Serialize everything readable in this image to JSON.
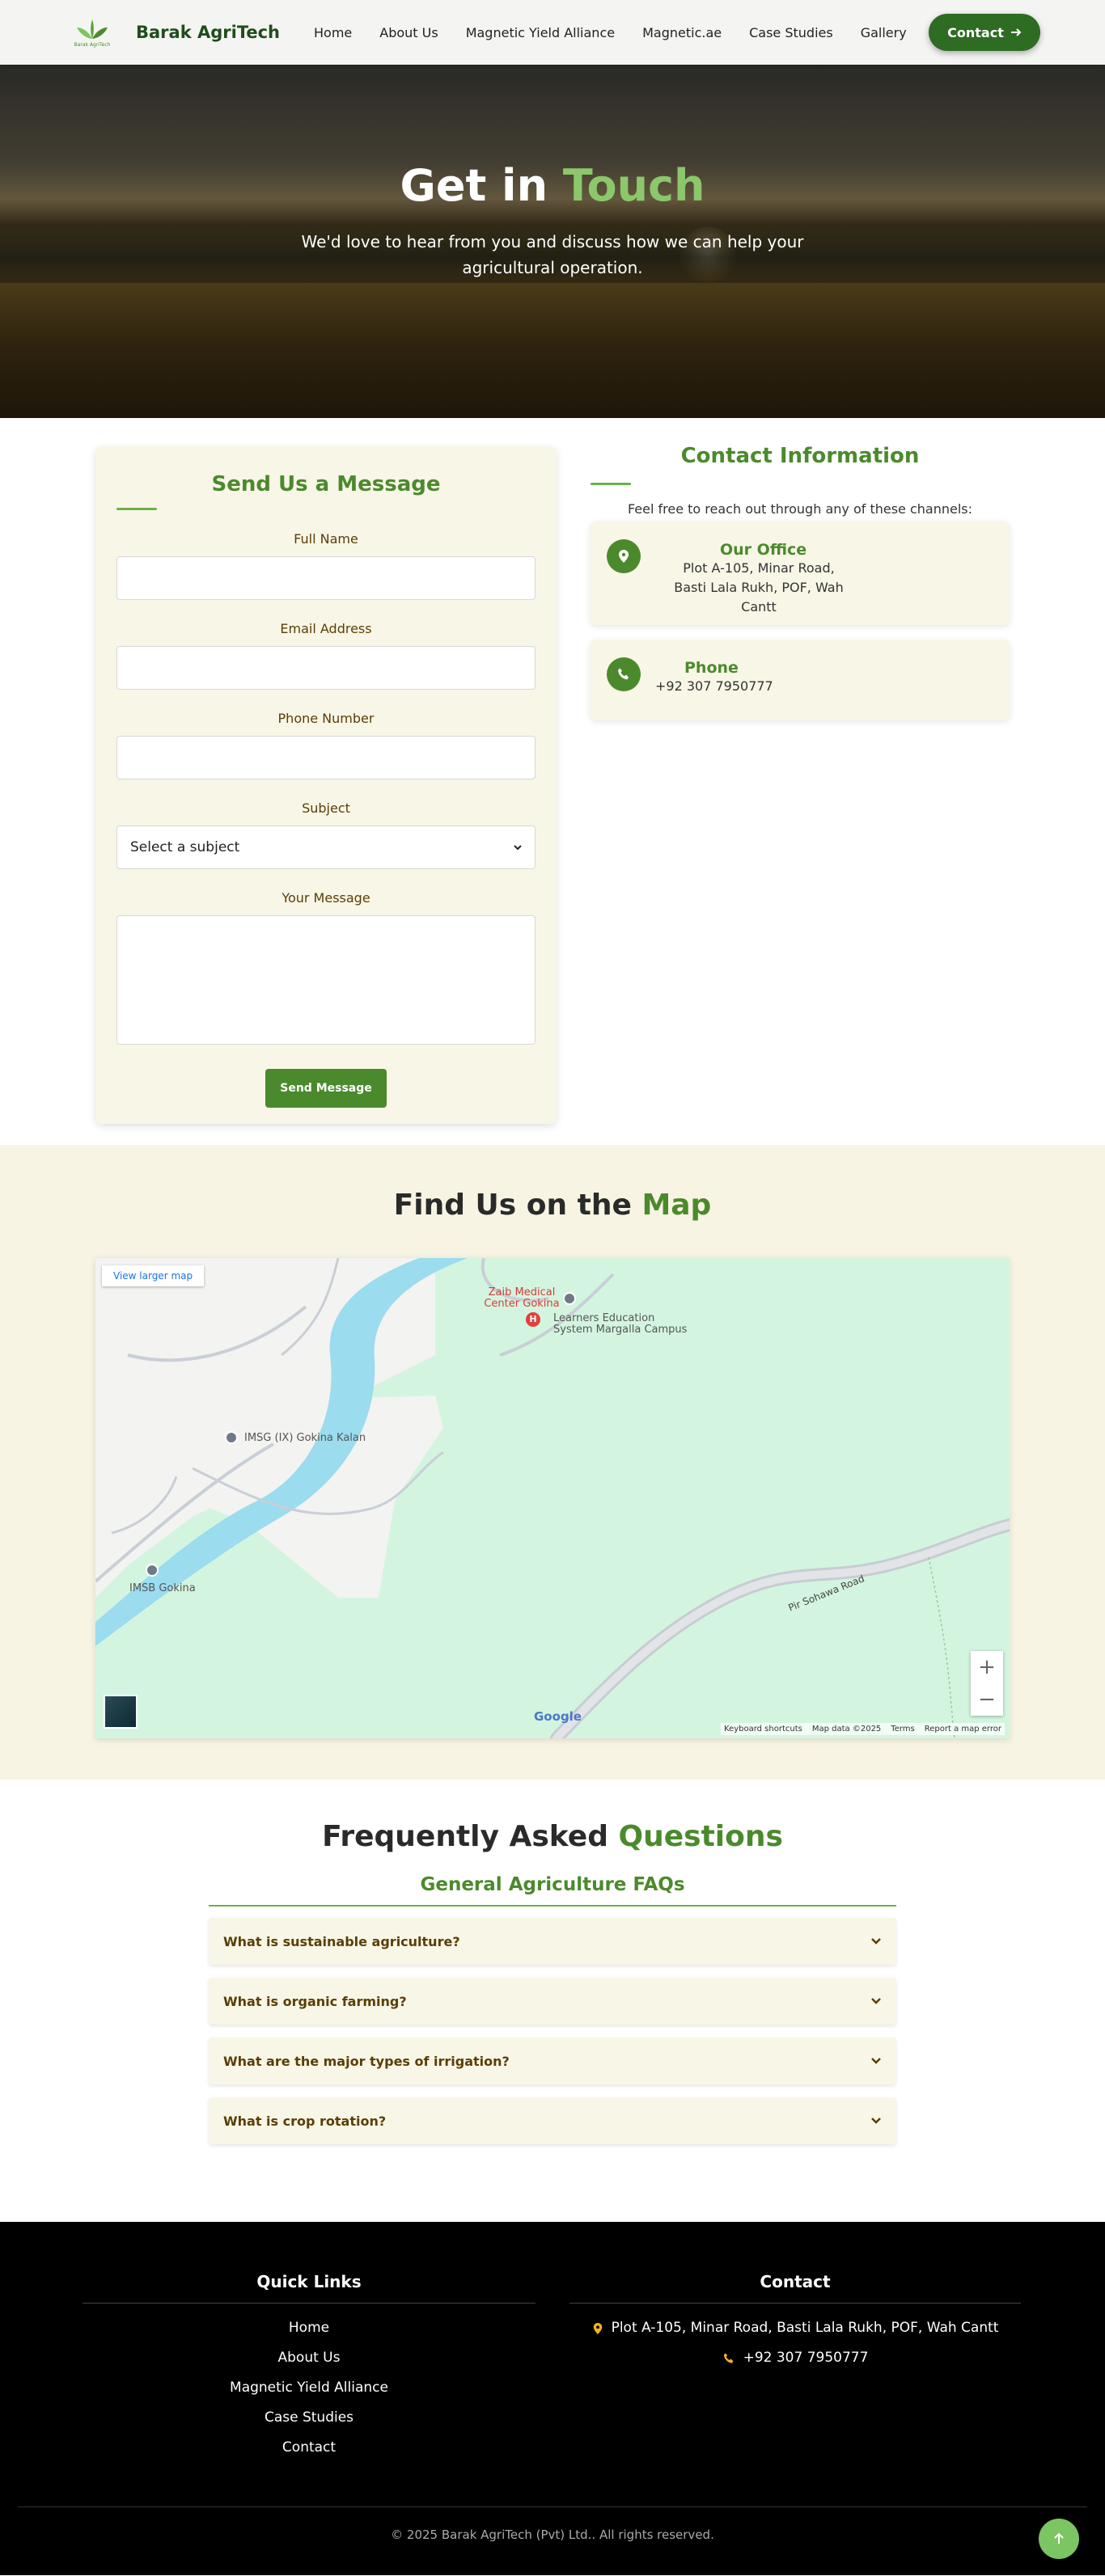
{
  "brand": {
    "name": "Barak AgriTech",
    "logo_text": "Barak AgriTech"
  },
  "nav": {
    "items": [
      {
        "label": "Home"
      },
      {
        "label": "About Us"
      },
      {
        "label": "Magnetic Yield Alliance"
      },
      {
        "label": "Magnetic.ae"
      },
      {
        "label": "Case Studies"
      },
      {
        "label": "Gallery"
      }
    ],
    "cta_label": "Contact"
  },
  "hero": {
    "title_plain": "Get in",
    "title_accent": "Touch",
    "subtitle": "We'd love to hear from you and discuss how we can help your agricultural operation."
  },
  "form": {
    "title": "Send Us a Message",
    "full_name_label": "Full Name",
    "email_label": "Email Address",
    "phone_label": "Phone Number",
    "subject_label": "Subject",
    "subject_value": "Select a subject",
    "message_label": "Your Message",
    "submit_label": "Send Message"
  },
  "contact_info": {
    "title": "Contact Information",
    "lead": "Feel free to reach out through any of these channels:",
    "office": {
      "title": "Our Office",
      "line1": "Plot A-105, Minar Road,",
      "line2": "Basti Lala Rukh, POF, Wah Cantt"
    },
    "phone": {
      "title": "Phone",
      "number": "+92 307 7950777"
    }
  },
  "map_section": {
    "title_plain": "Find Us on the",
    "title_accent": "Map",
    "larger_map_label": "View larger map",
    "pois": {
      "zaib": "Zaib Medical Center Gokina",
      "learners": "Learners Education System Margalla Campus",
      "imsg_ix": "IMSG (IX) Gokina Kalan",
      "imsb": "IMSB Gokina",
      "road": "Pir Sohawa Road"
    },
    "zoom_in": "+",
    "zoom_out": "−",
    "google": "Google",
    "attribution": {
      "shortcuts": "Keyboard shortcuts",
      "data": "Map data ©2025",
      "terms": "Terms",
      "report": "Report a map error"
    }
  },
  "faq": {
    "title_plain": "Frequently Asked",
    "title_accent": "Questions",
    "category": "General Agriculture FAQs",
    "items": [
      {
        "q": "What is sustainable agriculture?"
      },
      {
        "q": "What is organic farming?"
      },
      {
        "q": "What are the major types of irrigation?"
      },
      {
        "q": "What is crop rotation?"
      }
    ]
  },
  "footer": {
    "links_title": "Quick Links",
    "links": [
      {
        "label": "Home"
      },
      {
        "label": "About Us"
      },
      {
        "label": "Magnetic Yield Alliance"
      },
      {
        "label": "Case Studies"
      },
      {
        "label": "Contact"
      }
    ],
    "contact_title": "Contact",
    "address": "Plot A-105, Minar Road, Basti Lala Rukh, POF, Wah Cantt",
    "phone": "+92 307 7950777",
    "copyright": "© 2025 Barak AgriTech (Pvt) Ltd.. All rights reserved."
  },
  "colors": {
    "primary": "#4b8a2c",
    "dark_green": "#2e6b23",
    "accent_light": "#8cc76b",
    "cream": "#f8f6e6",
    "brown_text": "#5a3e07"
  }
}
